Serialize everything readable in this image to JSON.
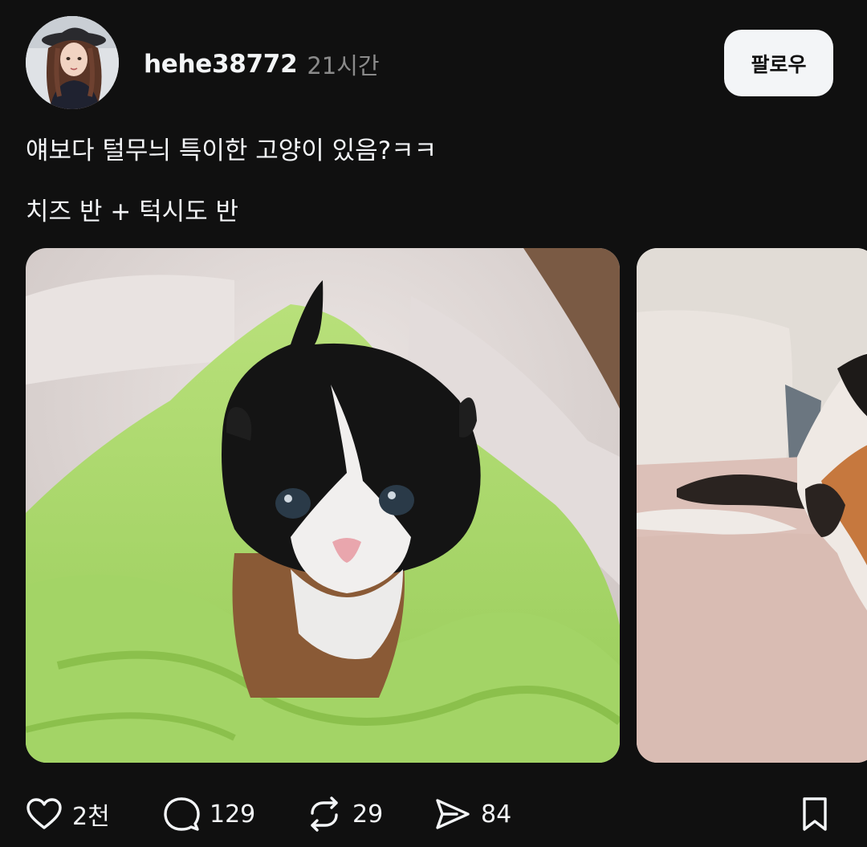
{
  "post": {
    "username": "hehe38772",
    "timestamp": "21시간",
    "follow_label": "팔로우",
    "text_line_1": "얘보다 털무늬 특이한 고양이 있음?ㅋㅋ",
    "text_line_2": "치즈 반 + 턱시도 반"
  },
  "media": [
    {
      "name": "kitten-photo",
      "description_icon": "photo"
    },
    {
      "name": "cat-on-bed-photo",
      "description_icon": "photo"
    }
  ],
  "actions": {
    "likes": "2천",
    "comments": "129",
    "reposts": "29",
    "shares": "84"
  },
  "icons": {
    "like": "heart-icon",
    "comment": "comment-bubble-icon",
    "repost": "repost-icon",
    "share": "send-icon",
    "save": "bookmark-icon"
  },
  "colors": {
    "background": "#101010",
    "text": "#f3f5f7",
    "muted": "#8a8a8a",
    "follow_button_bg": "#f3f5f7"
  }
}
